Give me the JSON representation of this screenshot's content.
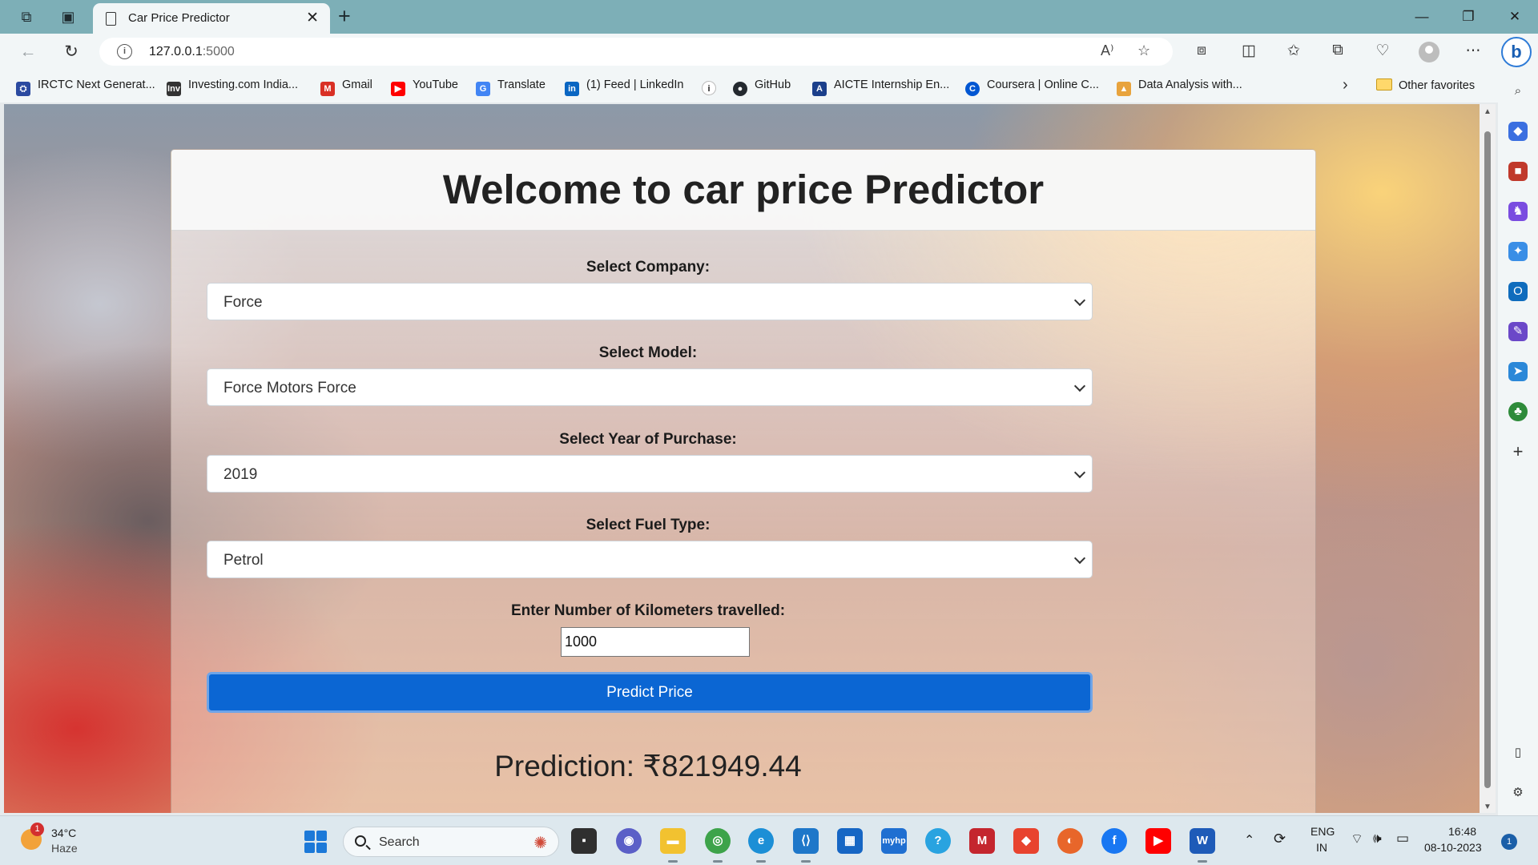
{
  "browser": {
    "tab_title": "Car Price Predictor",
    "url_host": "127.0.0.1",
    "url_port": ":5000",
    "favorites": [
      {
        "label": "IRCTC Next Generat...",
        "icon": "irctc-icon",
        "color": "#2b4aa0"
      },
      {
        "label": "Investing.com India...",
        "icon": "investing-icon",
        "color": "#333333"
      },
      {
        "label": "Gmail",
        "icon": "gmail-icon",
        "color": "#d93025"
      },
      {
        "label": "YouTube",
        "icon": "youtube-icon",
        "color": "#ff0000"
      },
      {
        "label": "Translate",
        "icon": "translate-icon",
        "color": "#4285f4"
      },
      {
        "label": "(1) Feed | LinkedIn",
        "icon": "linkedin-icon",
        "color": "#0a66c2"
      },
      {
        "label": "",
        "icon": "info-icon",
        "color": "#222222"
      },
      {
        "label": "GitHub",
        "icon": "github-icon",
        "color": "#24292f"
      },
      {
        "label": "AICTE Internship En...",
        "icon": "aicte-icon",
        "color": "#1b3f8b"
      },
      {
        "label": "Coursera | Online C...",
        "icon": "coursera-icon",
        "color": "#0056d2"
      },
      {
        "label": "Data Analysis with...",
        "icon": "data-analysis-icon",
        "color": "#e8a33d"
      }
    ],
    "other_favorites": "Other favorites"
  },
  "page": {
    "title": "Welcome to car price Predictor",
    "company_label": "Select Company:",
    "company_value": "Force",
    "model_label": "Select Model:",
    "model_value": "Force Motors Force",
    "year_label": "Select Year of Purchase:",
    "year_value": "2019",
    "fuel_label": "Select Fuel Type:",
    "fuel_value": "Petrol",
    "km_label": "Enter Number of Kilometers travelled:",
    "km_value": "1000",
    "predict_button": "Predict Price",
    "prediction": "Prediction: ₹821949.44"
  },
  "taskbar": {
    "weather_badge": "1",
    "temperature": "34°C",
    "condition": "Haze",
    "search_placeholder": "Search",
    "language_1": "ENG",
    "language_2": "IN",
    "time": "16:48",
    "date": "08-10-2023",
    "notification_count": "1"
  }
}
